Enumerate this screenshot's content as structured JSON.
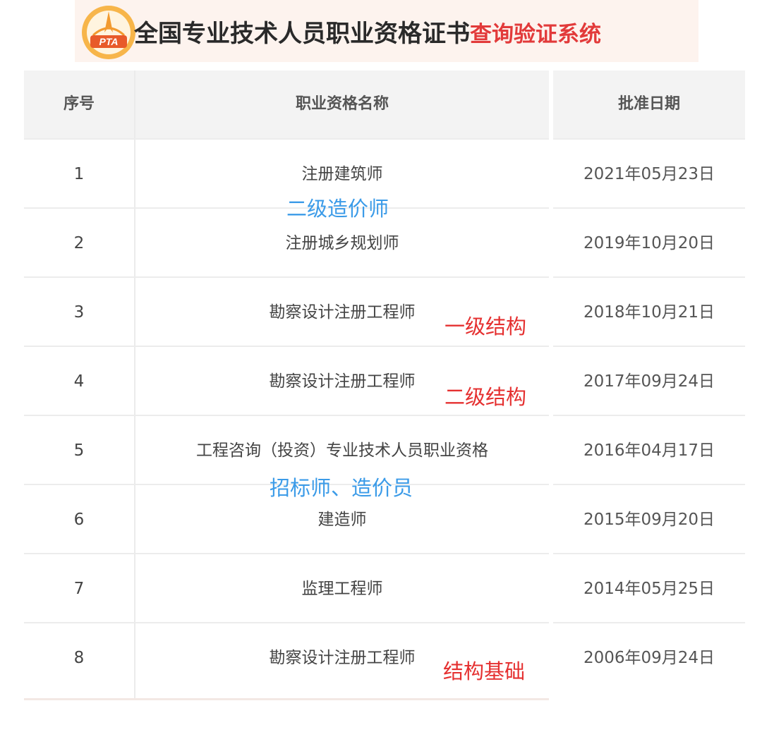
{
  "header": {
    "logo_text": "PTA",
    "title_main": "全国专业技术人员职业资格证书",
    "title_accent": "查询验证系统"
  },
  "table": {
    "col_seq": "序号",
    "col_name": "职业资格名称",
    "col_date": "批准日期",
    "rows": [
      {
        "seq": "1",
        "name": "注册建筑师",
        "date": "2021年05月23日"
      },
      {
        "seq": "2",
        "name": "注册城乡规划师",
        "date": "2019年10月20日"
      },
      {
        "seq": "3",
        "name": "勘察设计注册工程师",
        "date": "2018年10月21日"
      },
      {
        "seq": "4",
        "name": "勘察设计注册工程师",
        "date": "2017年09月24日"
      },
      {
        "seq": "5",
        "name": "工程咨询（投资）专业技术人员职业资格",
        "date": "2016年04月17日"
      },
      {
        "seq": "6",
        "name": "建造师",
        "date": "2015年09月20日"
      },
      {
        "seq": "7",
        "name": "监理工程师",
        "date": "2014年05月25日"
      },
      {
        "seq": "8",
        "name": "勘察设计注册工程师",
        "date": "2006年09月24日"
      }
    ]
  },
  "annotations": {
    "a1": "二级造价师",
    "a2": "一级结构",
    "a3": "二级结构",
    "a4": "招标师、造价员",
    "a5": "结构基础"
  },
  "colors": {
    "accent_red": "#e23a3a",
    "annotation_blue": "#3b9be8",
    "annotation_red": "#e53030",
    "logo_orange": "#f2a23a"
  }
}
